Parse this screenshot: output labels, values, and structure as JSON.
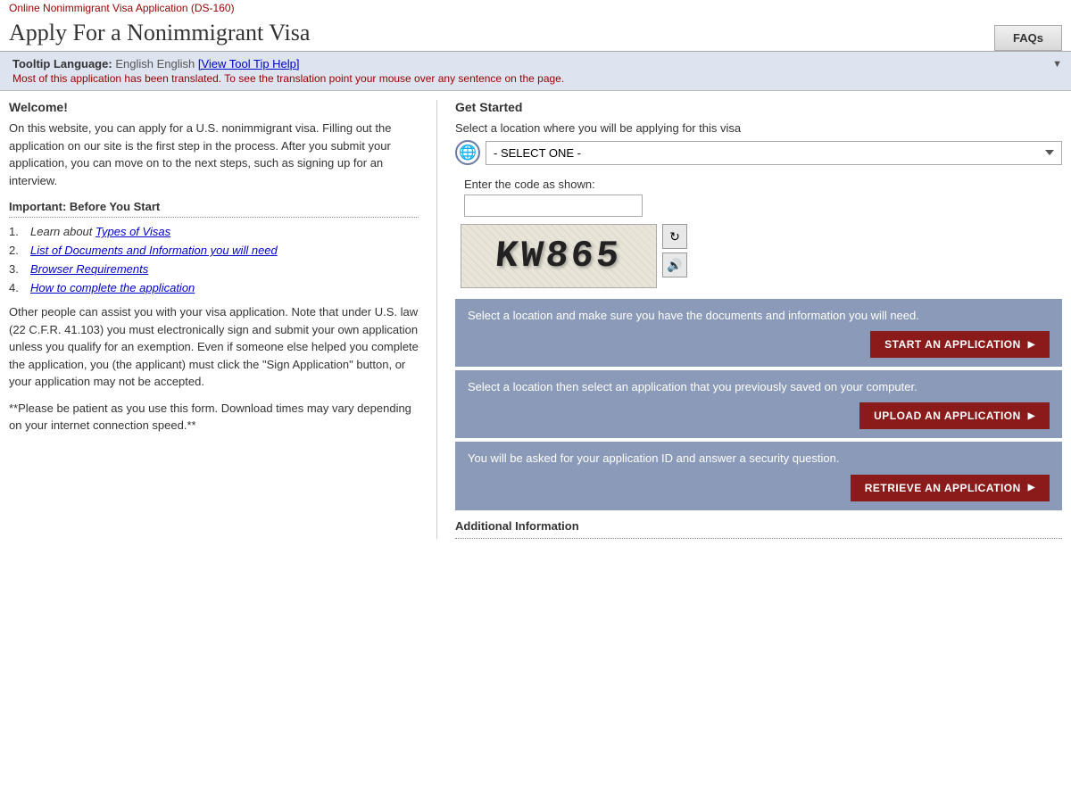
{
  "page": {
    "subtitle": "Online Nonimmigrant Visa Application (DS-160)",
    "title": "Apply For a Nonimmigrant Visa",
    "faqs_button": "FAQs"
  },
  "tooltip_bar": {
    "prefix": "Tooltip Language:",
    "language": "English",
    "link": "[View Tool Tip Help]",
    "description": "Most of this application has been translated. To see the translation point your mouse over any sentence on the page."
  },
  "left_col": {
    "welcome_heading": "Welcome!",
    "welcome_text": "On this website, you can apply for a U.S. nonimmigrant visa. Filling out the application on our site is the first step in the process. After you submit your application, you can move on to the next steps, such as signing up for an interview.",
    "important_heading": "Important: Before You Start",
    "list_items": [
      {
        "num": "1.",
        "text": "Learn about ",
        "link": "Types of Visas",
        "after": ""
      },
      {
        "num": "2.",
        "text": "",
        "link": "List of Documents and Information you will need",
        "after": ""
      },
      {
        "num": "3.",
        "text": "",
        "link": "Browser Requirements",
        "after": ""
      },
      {
        "num": "4.",
        "text": "",
        "link": "How to complete the application",
        "after": ""
      }
    ],
    "body_text1": "Other people can assist you with your visa application. Note that under U.S. law (22 C.F.R. 41.103) you must electronically sign and submit your own application unless you qualify for an exemption. Even if someone else helped you complete the application, you (the applicant) must click the \"Sign Application\" button, or your application may not be accepted.",
    "body_text2": "**Please be patient as you use this form. Download times may vary depending on your internet connection speed.**"
  },
  "right_col": {
    "get_started_heading": "Get Started",
    "location_label": "Select a location where you will be applying for this visa",
    "select_placeholder": "- SELECT ONE -",
    "captcha_label": "Enter the code as shown:",
    "captcha_text": "KW865",
    "captcha_refresh_title": "Refresh captcha",
    "captcha_audio_title": "Audio captcha",
    "action_sections": [
      {
        "text": "Select a location and make sure you have the documents and information you will need.",
        "button": "START AN APPLICATION"
      },
      {
        "text": "Select a location then select an application that you previously saved on your computer.",
        "button": "UPLOAD AN APPLICATION"
      },
      {
        "text": "You will be asked for your application ID and answer a security question.",
        "button": "RETRIEVE AN APPLICATION"
      }
    ],
    "additional_info_label": "Additional Information"
  },
  "colors": {
    "dark_red": "#8b1a1a",
    "blue_gray": "#8a9ab8",
    "light_blue_gray": "#dde3ef",
    "link_blue": "#0000cc"
  }
}
